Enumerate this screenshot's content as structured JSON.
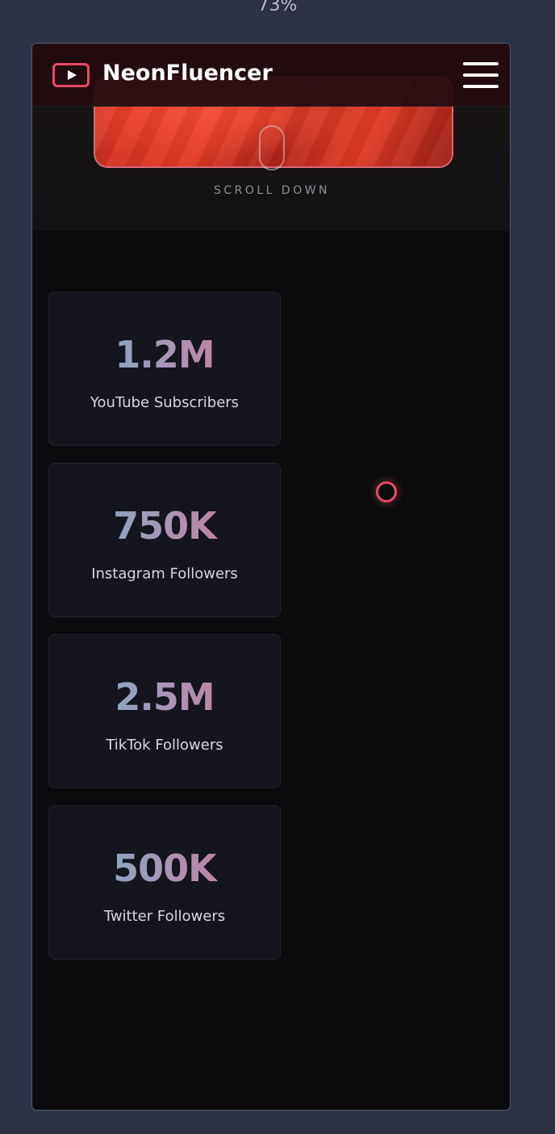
{
  "browser": {
    "zoom": "73%"
  },
  "header": {
    "brand": "NeonFluencer",
    "logo_icon": "play-icon",
    "menu_icon": "hamburger-icon",
    "accent_color": "#e74a64"
  },
  "hero": {
    "scroll_label": "SCROLL DOWN",
    "scroll_icon": "mouse-icon"
  },
  "stats": [
    {
      "value": "1.2M",
      "label": "YouTube Subscribers"
    },
    {
      "value": "750K",
      "label": "Instagram Followers"
    },
    {
      "value": "2.5M",
      "label": "TikTok Followers"
    },
    {
      "value": "500K",
      "label": "Twitter Followers"
    }
  ],
  "colors": {
    "stat_gradient_start": "#69b8c9",
    "stat_gradient_end": "#d86f92",
    "card_background": "#15151d",
    "page_background": "#0b0b0e"
  }
}
